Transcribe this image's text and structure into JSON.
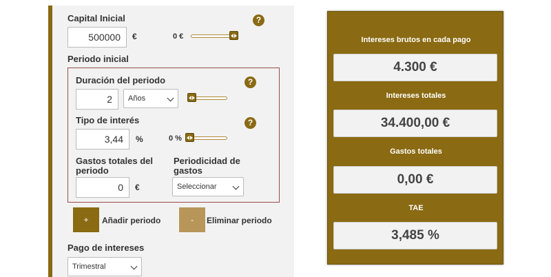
{
  "capital": {
    "label": "Capital Inicial",
    "value": "500000",
    "unit": "€",
    "slider_value": "0 €"
  },
  "periodo": {
    "heading": "Periodo inicial",
    "duracion_label": "Duración del periodo",
    "duracion_value": "2",
    "duracion_unit_selected": "Años",
    "tipo_label": "Tipo de interés",
    "tipo_value": "3,44",
    "tipo_unit": "%",
    "tipo_slider_value": "0 %",
    "gastos_label": "Gastos totales del periodo",
    "gastos_value": "0",
    "gastos_unit": "€",
    "periodicidad_label": "Periodicidad de gastos",
    "periodicidad_selected": "Seleccionar"
  },
  "buttons": {
    "add_symbol": "+",
    "add_label": "Añadir periodo",
    "remove_symbol": "-",
    "remove_label": "Eliminar periodo"
  },
  "pago": {
    "label": "Pago de intereses",
    "selected": "Trimestral"
  },
  "help_symbol": "?",
  "results": {
    "brutos_label": "Intereses brutos en cada pago",
    "brutos_value": "4.300 €",
    "totales_label": "Intereses totales",
    "totales_value": "34.400,00 €",
    "gastos_label": "Gastos totales",
    "gastos_value": "0,00 €",
    "tae_label": "TAE",
    "tae_value": "3,485 %"
  },
  "colors": {
    "brand": "#8a6a12",
    "secondary_button": "#b8965a",
    "period_border": "#9b4a4a"
  }
}
